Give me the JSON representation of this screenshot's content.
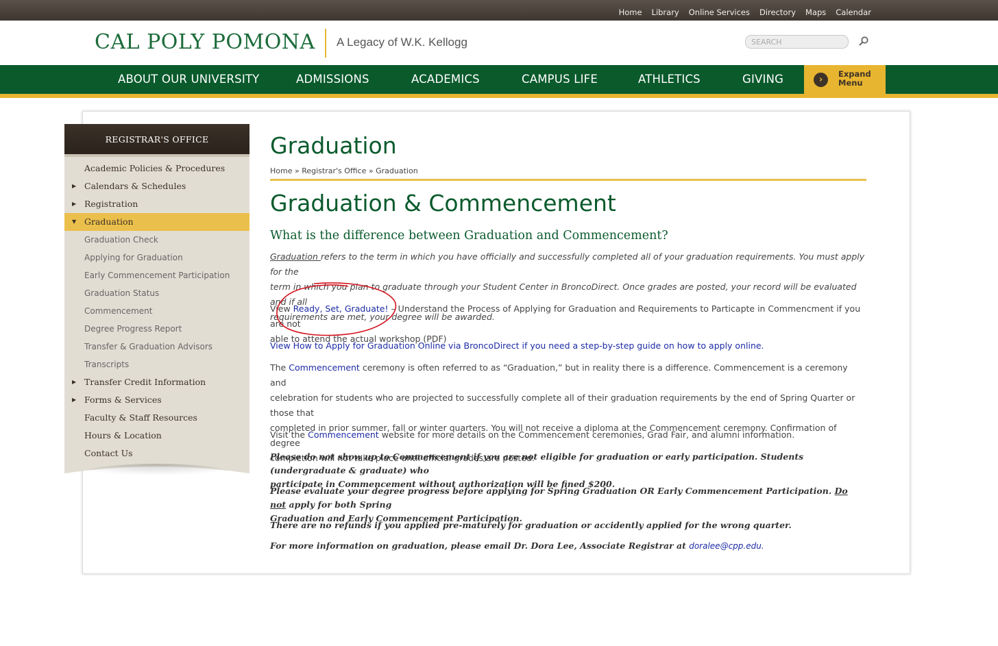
{
  "utility_nav": {
    "links": [
      "Home",
      "Library",
      "Online Services",
      "Directory",
      "Maps",
      "Calendar"
    ]
  },
  "header": {
    "logo": "CAL POLY POMONA",
    "tagline": "A Legacy of W.K. Kellogg",
    "search_placeholder": "SEARCH"
  },
  "main_nav": {
    "items": [
      "ABOUT OUR UNIVERSITY",
      "ADMISSIONS",
      "ACADEMICS",
      "CAMPUS LIFE",
      "ATHLETICS",
      "GIVING"
    ],
    "expand_label": "Expand Menu"
  },
  "sidebar": {
    "title": "REGISTRAR'S OFFICE",
    "items": [
      {
        "label": "Academic Policies & Procedures",
        "arrow": ""
      },
      {
        "label": "Calendars & Schedules",
        "arrow": "▶"
      },
      {
        "label": "Registration",
        "arrow": "▶"
      },
      {
        "label": "Graduation",
        "arrow": "▼"
      },
      {
        "label": "Graduation Check",
        "arrow": ""
      },
      {
        "label": "Applying for Graduation",
        "arrow": ""
      },
      {
        "label": "Early Commencement Participation",
        "arrow": ""
      },
      {
        "label": "Graduation Status",
        "arrow": ""
      },
      {
        "label": "Commencement",
        "arrow": ""
      },
      {
        "label": "Degree Progress Report",
        "arrow": ""
      },
      {
        "label": "Transfer & Graduation Advisors",
        "arrow": ""
      },
      {
        "label": "Transcripts",
        "arrow": ""
      },
      {
        "label": "Transfer Credit Information",
        "arrow": "▶"
      },
      {
        "label": "Forms & Services",
        "arrow": "▶"
      },
      {
        "label": "Faculty & Staff Resources",
        "arrow": ""
      },
      {
        "label": "Hours & Location",
        "arrow": ""
      },
      {
        "label": "Contact Us",
        "arrow": ""
      }
    ]
  },
  "content": {
    "page_title": "Graduation",
    "breadcrumb": {
      "home": "Home",
      "sep": " » ",
      "parent": "Registrar's Office",
      "current": "Graduation"
    },
    "heading": "Graduation & Commencement",
    "subheading": "What is the difference between Graduation and Commencement?",
    "p1": {
      "term": "Graduation ",
      "text_line1": "refers to the term in which you have officially and successfully completed all of your graduation requirements. You must apply for the",
      "text_line2": "term in which you plan to graduate through your Student Center in BroncoDirect.  Once grades are posted, your record will be evaluated and if all",
      "text_line3": "requirements are met, your degree will be awarded."
    },
    "p2": {
      "prefix": "View ",
      "link": "Ready, Set, Graduate!",
      "text_line1": " – Understand the Process of Applying for Graduation and Requirements to Particapte in Commencment if you are not",
      "text_line2": "able to attend the actual workshop (PDF)"
    },
    "p3": {
      "link": "View How to Apply for Graduation Online via BroncoDirect if you need a step-by-step guide on how to apply online."
    },
    "p4": {
      "prefix": "The ",
      "link": "Commencement",
      "text_line1": " ceremony is often referred to as “Graduation,” but in reality there is a difference. Commencement is a ceremony and",
      "text_line2": "celebration for students who are projected to successfully complete all of their graduation requirements by the end of Spring Quarter or those that",
      "text_line3": "completed in prior summer, fall or winter quarters.  You will not receive a diploma at the Commencement ceremony. Confirmation of degree",
      "text_line4": "completion will not take place until official grades are posted."
    },
    "p5": {
      "prefix": "Visit the ",
      "link": "Commencement",
      "text": " website for more details on the Commencement ceremonies, Grad Fair, and alumni information."
    },
    "notice1": {
      "line1": "Please do not show up to Commencement if you are not eligible for graduation or early participation. Students (undergraduate & graduate) who",
      "line2": "participate in Commencement without authorization will be fined $200."
    },
    "notice2": {
      "line1a": "Please evaluate your degree progress before applying for Spring Graduation OR Early Commencement Participation.  ",
      "line1b": "Do not",
      "line1c": " apply for both Spring",
      "line2": "Graduation and Early Commencement Participation."
    },
    "notice3": "There are no refunds if you applied pre-maturely for graduation or accidently applied for the wrong quarter.",
    "notice4": {
      "text": "For more information on graduation, please email Dr. Dora Lee, Associate Registrar at ",
      "email": "doralee@cpp.edu."
    }
  },
  "colors": {
    "brand_green": "#0a5a2c",
    "brand_gold": "#e8b530",
    "link_blue": "#1c2ba5",
    "annotation_red": "#d4111b"
  }
}
